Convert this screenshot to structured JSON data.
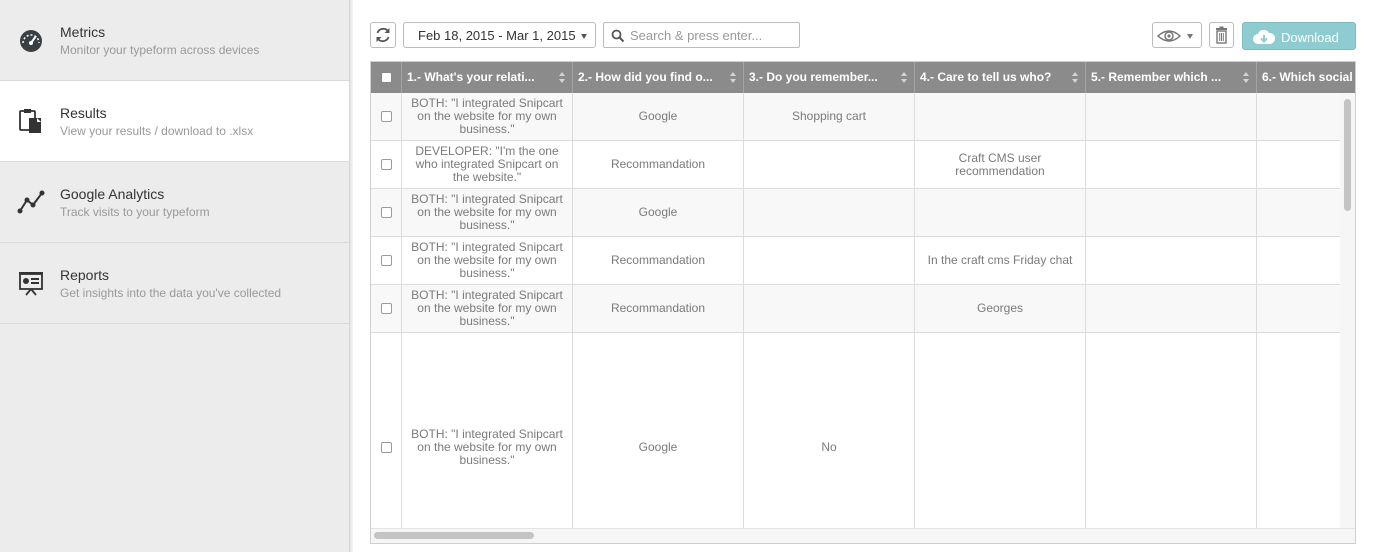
{
  "sidebar": {
    "items": [
      {
        "title": "Metrics",
        "subtitle": "Monitor your typeform across devices",
        "icon": "speedometer-icon"
      },
      {
        "title": "Results",
        "subtitle": "View your results / download to .xlsx",
        "icon": "clipboard-icon"
      },
      {
        "title": "Google Analytics",
        "subtitle": "Track visits to your typeform",
        "icon": "line-graph-icon"
      },
      {
        "title": "Reports",
        "subtitle": "Get insights into the data you've collected",
        "icon": "presentation-icon"
      }
    ],
    "active": "Results"
  },
  "toolbar": {
    "date_range": "Feb 18, 2015 - Mar 1, 2015",
    "search_placeholder": "Search & press enter...",
    "search_value": "",
    "download_label": "Download",
    "accent_color": "#8fccd1"
  },
  "table": {
    "columns": [
      "1.- What's your relati...",
      "2.- How did you find o...",
      "3.- Do you remember...",
      "4.- Care to tell us who?",
      "5.- Remember which ...",
      "6.- Which social"
    ],
    "rows": [
      [
        "BOTH: \"I integrated Snipcart on the website for my own business.\"",
        "Google",
        "Shopping cart",
        "",
        "",
        ""
      ],
      [
        "DEVELOPER: \"I'm the one who integrated Snipcart on the website.\"",
        "Recommandation",
        "",
        "Craft CMS user recommendation",
        "",
        ""
      ],
      [
        "BOTH: \"I integrated Snipcart on the website for my own business.\"",
        "Google",
        "",
        "",
        "",
        ""
      ],
      [
        "BOTH: \"I integrated Snipcart on the website for my own business.\"",
        "Recommandation",
        "",
        "In the craft cms Friday chat",
        "",
        ""
      ],
      [
        "BOTH: \"I integrated Snipcart on the website for my own business.\"",
        "Recommandation",
        "",
        "Georges",
        "",
        ""
      ],
      [
        "BOTH: \"I integrated Snipcart on the website for my own business.\"",
        "Google",
        "No",
        "",
        "",
        ""
      ]
    ]
  }
}
